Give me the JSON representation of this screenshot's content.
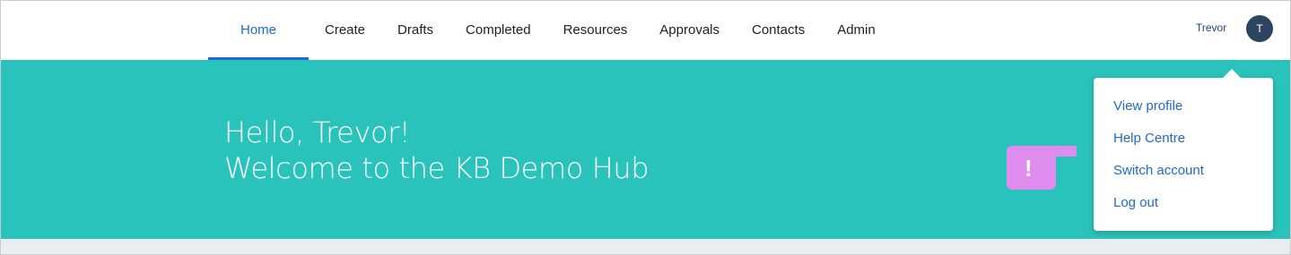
{
  "nav": {
    "items": [
      {
        "label": "Home",
        "active": true
      },
      {
        "label": "Create"
      },
      {
        "label": "Drafts"
      },
      {
        "label": "Completed"
      },
      {
        "label": "Resources"
      },
      {
        "label": "Approvals"
      },
      {
        "label": "Contacts"
      },
      {
        "label": "Admin"
      }
    ]
  },
  "user": {
    "name": "Trevor",
    "initial": "T"
  },
  "hero": {
    "greeting": "Hello, Trevor!",
    "welcome": "Welcome to the KB Demo Hub"
  },
  "notice": {
    "mark": "!"
  },
  "profile_menu": {
    "items": [
      {
        "label": "View profile"
      },
      {
        "label": "Help Centre"
      },
      {
        "label": "Switch account"
      },
      {
        "label": "Log out"
      }
    ]
  },
  "colors": {
    "accent": "#1f68d4",
    "hero_background": "#2ac3bb",
    "notice_tab": "#de8cee",
    "avatar_background": "#2d4660"
  },
  "icons": {
    "notice": "exclamation-icon",
    "avatar": "user-avatar-icon"
  }
}
